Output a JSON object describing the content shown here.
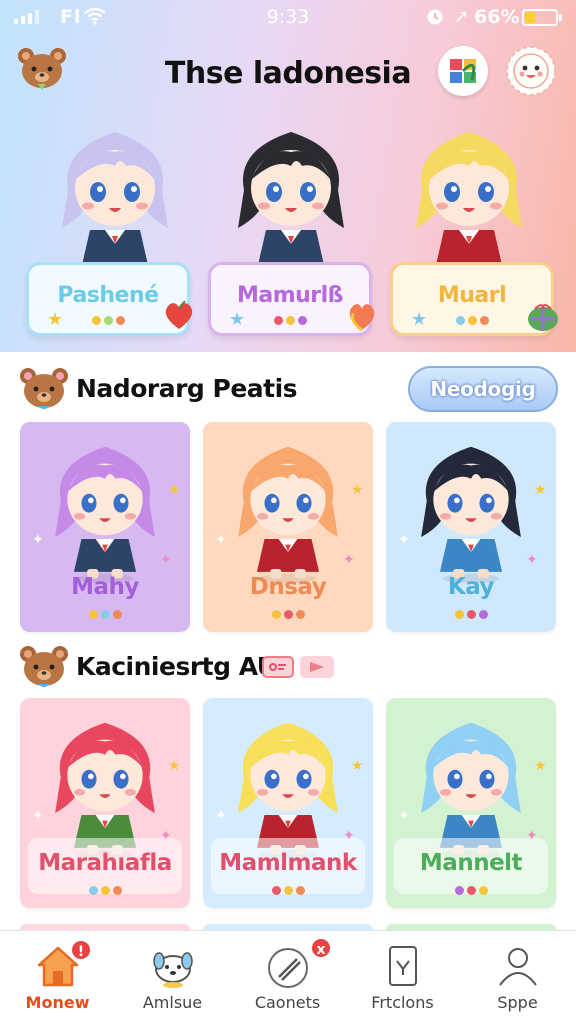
{
  "status_bar": {
    "carrier": "Fl",
    "time": "9:33",
    "battery_percent": "66%",
    "icons": [
      "signal-icon",
      "wifi-icon",
      "alarm-icon",
      "location-icon",
      "battery-icon"
    ]
  },
  "header": {
    "title": "Thse ladonesia",
    "icons": [
      "bear-logo-icon",
      "pinwheel-icon",
      "smiley-sun-icon"
    ]
  },
  "featured": [
    {
      "name": "Pashené",
      "name_color": "#6ccbe8",
      "card_bg": "#f1fbff",
      "card_border": "#a9e0f5",
      "hair": "#c8c3ef",
      "outfit": "#2e4466",
      "dots": [
        "#f6c43c",
        "#a9d873",
        "#f08a55"
      ]
    },
    {
      "name": "Mamurlß",
      "name_color": "#b469dc",
      "card_bg": "#fbf2ff",
      "card_border": "#d7b4ee",
      "hair": "#2b2b2f",
      "outfit": "#2e4466",
      "dots": [
        "#e7596b",
        "#f6c43c",
        "#b46ad9"
      ]
    },
    {
      "name": "Muarl",
      "name_color": "#f2b640",
      "card_bg": "#fff7e6",
      "card_border": "#f7d08b",
      "hair": "#f6d960",
      "outfit": "#b8232d",
      "dots": [
        "#88ccea",
        "#f6c43c",
        "#f08a55"
      ]
    }
  ],
  "sections": [
    {
      "title": "Nadorarg Peatis",
      "action_label": "Neodogig",
      "cards": [
        {
          "name": "Mahy",
          "name_color": "#a25fd9",
          "bg": "#d7b9f2",
          "hair": "#c58ae8",
          "outfit": "#2e4466",
          "dots": [
            "#f6c43c",
            "#88ccea",
            "#f08a55"
          ]
        },
        {
          "name": "Dnsay",
          "name_color": "#f08a55",
          "bg": "#ffd9bf",
          "hair": "#f8a86c",
          "outfit": "#b8232d",
          "dots": [
            "#f6c43c",
            "#e7596b",
            "#f08a55"
          ]
        },
        {
          "name": "Kay",
          "name_color": "#4fb2dd",
          "bg": "#cfe8fb",
          "hair": "#23283a",
          "outfit": "#3b86c4",
          "dots": [
            "#f6c43c",
            "#e7596b",
            "#b46ad9"
          ]
        }
      ]
    },
    {
      "title": "Kaciniesrtg AU",
      "cards": [
        {
          "name": "Marahıafla",
          "name_color": "#e2506b",
          "bg": "#ffd3dc",
          "hair": "#e8475f",
          "outfit": "#4b8c3c",
          "dots": [
            "#88ccea",
            "#f6c43c",
            "#f08a55"
          ]
        },
        {
          "name": "Mamlmank",
          "name_color": "#e2506b",
          "bg": "#d5ebff",
          "hair": "#f7df5a",
          "outfit": "#b8232d",
          "dots": [
            "#e7596b",
            "#f6c43c",
            "#f08a55"
          ]
        },
        {
          "name": "Mannelt",
          "name_color": "#4cae5b",
          "bg": "#d3f2d1",
          "hair": "#8fd0f4",
          "outfit": "#3b86c4",
          "dots": [
            "#b46ad9",
            "#e7596b",
            "#f6c43c"
          ]
        }
      ]
    }
  ],
  "bottom_nav": [
    {
      "label": "Monew",
      "icon": "home-icon",
      "active": true,
      "badge": "!"
    },
    {
      "label": "Amlsue",
      "icon": "pet-icon",
      "active": false
    },
    {
      "label": "Caonets",
      "icon": "brush-icon",
      "active": false,
      "badge": "x"
    },
    {
      "label": "Frtclons",
      "icon": "phone-icon",
      "active": false
    },
    {
      "label": "Sppe",
      "icon": "profile-icon",
      "active": false
    }
  ],
  "colors": {
    "accent": "#e24f1c",
    "badge": "#e84242"
  }
}
